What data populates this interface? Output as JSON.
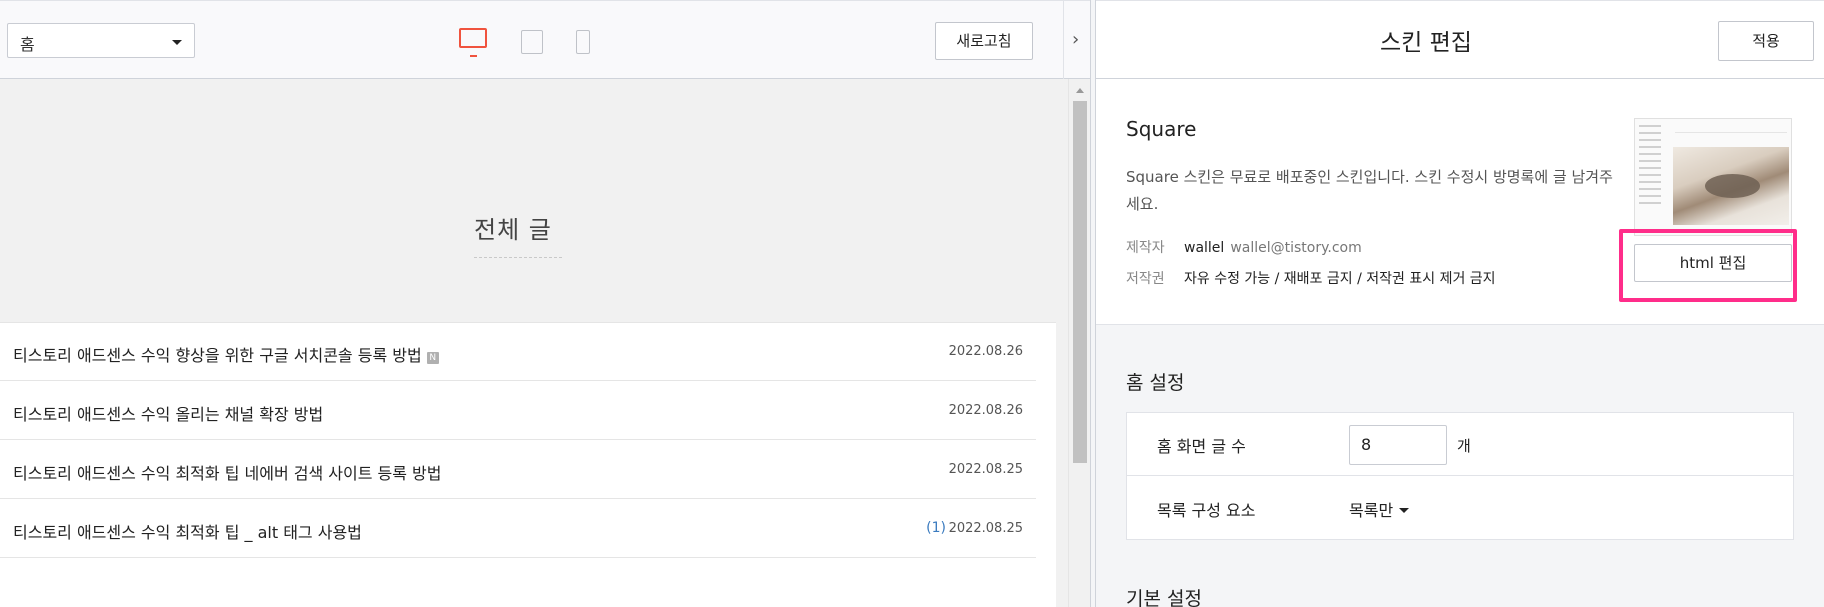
{
  "preview_toolbar": {
    "page_select_value": "홈",
    "devices": [
      "desktop-icon",
      "tablet-icon",
      "mobile-icon"
    ],
    "active_device": "desktop",
    "refresh_label": "새로고침",
    "collapse_glyph": "›"
  },
  "preview": {
    "heading": "전체 글",
    "posts": [
      {
        "title": "티스토리 애드센스 수익 향상을 위한 구글 서치콘솔 등록 방법",
        "badge": "N",
        "comments": "",
        "date": "2022.08.26"
      },
      {
        "title": "티스토리 애드센스 수익 올리는 채널 확장 방법",
        "badge": "",
        "comments": "",
        "date": "2022.08.26"
      },
      {
        "title": "티스토리 애드센스 수익 최적화 팁 네에버 검색 사이트 등록 방법",
        "badge": "",
        "comments": "",
        "date": "2022.08.25"
      },
      {
        "title": "티스토리 애드센스 수익 최적화 팁 _ alt 태그 사용법",
        "badge": "",
        "comments": "(1)",
        "date": "2022.08.25"
      }
    ]
  },
  "editor": {
    "title": "스킨 편집",
    "apply_label": "적용",
    "skin": {
      "name": "Square",
      "description": "Square 스킨은 무료로 배포중인 스킨입니다. 스킨 수정시 방명록에 글 남겨주세요.",
      "author_key": "제작자",
      "author_name": "wallel",
      "author_email": "wallel@tistory.com",
      "license_key": "저작권",
      "license_value": "자유 수정 가능 / 재배포 금지 / 저작권 표시 제거 금지",
      "html_edit_label": "html 편집"
    },
    "home_settings": {
      "title": "홈 설정",
      "post_count_label": "홈 화면 글 수",
      "post_count_value": "8",
      "post_count_unit": "개",
      "list_component_label": "목록 구성 요소",
      "list_component_value": "목록만"
    },
    "basic_settings_title": "기본 설정"
  },
  "colors": {
    "accent_device": "#f0533e",
    "highlight": "#ff2d8a",
    "comment_count": "#3b7bbf"
  }
}
